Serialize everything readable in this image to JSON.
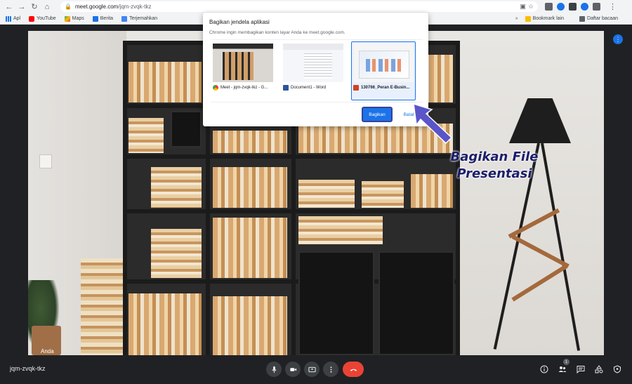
{
  "browser": {
    "url_host": "meet.google.com",
    "url_path": "/jqm-zvqk-tkz"
  },
  "bookmarks": {
    "items": [
      {
        "label": "Apl",
        "icon": "apps-icon"
      },
      {
        "label": "YouTube",
        "icon": "youtube-icon"
      },
      {
        "label": "Maps",
        "icon": "maps-icon"
      },
      {
        "label": "Berita",
        "icon": "news-icon"
      },
      {
        "label": "Terjemahkan",
        "icon": "translate-icon"
      }
    ],
    "right": [
      {
        "label": "Bookmark lain",
        "icon": "folder-icon"
      },
      {
        "label": "Daftar bacaan",
        "icon": "reading-list-icon"
      }
    ]
  },
  "dialog": {
    "title": "Bagikan jendela aplikasi",
    "subtitle": "Chrome ingin membagikan konten layar Anda ke meet.google.com.",
    "windows": [
      {
        "label": "Meet - jqm-zvqk-tkz - G...",
        "icon": "chrome-icon",
        "selected": false
      },
      {
        "label": "Document1 - Word",
        "icon": "word-icon",
        "selected": false
      },
      {
        "label": "130766_Peran E-Busin...",
        "icon": "powerpoint-icon",
        "selected": true
      }
    ],
    "share_label": "Bagikan",
    "cancel_label": "Batal"
  },
  "annotation": {
    "line1": "Bagikan File",
    "line2": "Presentasi",
    "color": "#1c1e6b",
    "arrow_color": "#5a55c8"
  },
  "stage": {
    "participant_name": "Anda"
  },
  "bottom_bar": {
    "meeting_code": "jqm-zvqk-tkz",
    "participants_count": "1",
    "controls": [
      "mic-icon",
      "camera-icon",
      "present-icon",
      "more-options-icon",
      "end-call-icon"
    ],
    "right_icons": [
      "info-icon",
      "people-icon",
      "chat-icon",
      "activities-icon",
      "host-controls-icon"
    ]
  },
  "colors": {
    "accent": "#1a73e8",
    "end_call": "#ea4335",
    "meet_bg": "#202124"
  }
}
